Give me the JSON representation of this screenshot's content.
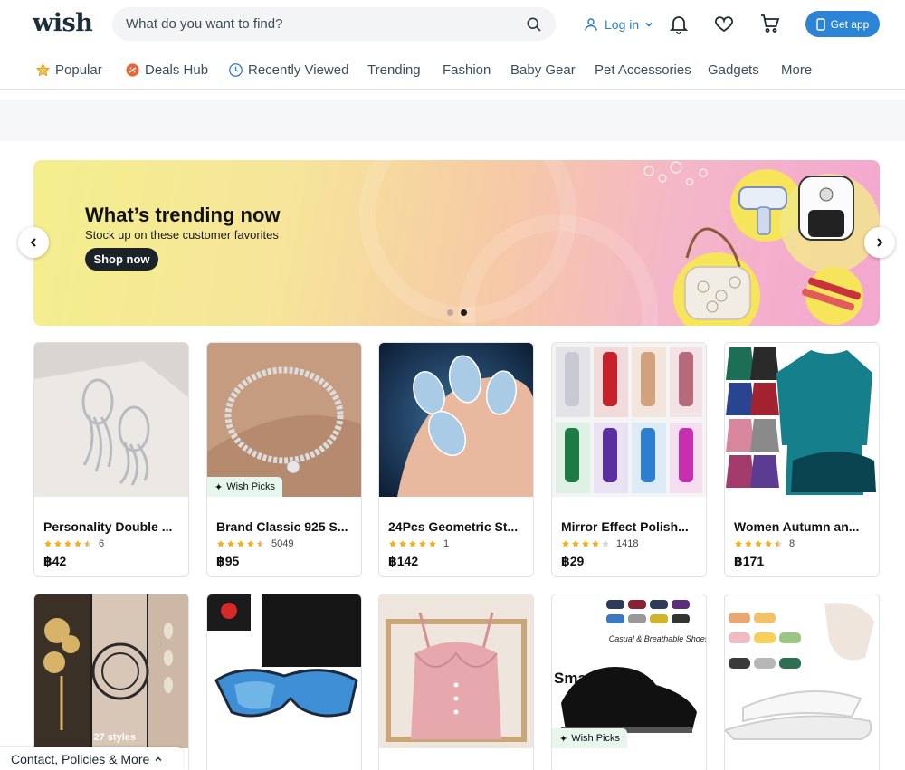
{
  "header": {
    "logo": "wish",
    "search_placeholder": "What do you want to find?",
    "login_label": "Log in",
    "get_app_label": "Get app",
    "icons": [
      "search-icon",
      "user-icon",
      "bell-icon",
      "heart-icon",
      "cart-icon",
      "phone-icon"
    ]
  },
  "nav": {
    "items": [
      {
        "label": "Popular",
        "icon": "star-icon"
      },
      {
        "label": "Deals Hub",
        "icon": "deals-icon"
      },
      {
        "label": "Recently Viewed",
        "icon": "clock-icon"
      },
      {
        "label": "Trending"
      },
      {
        "label": "Fashion"
      },
      {
        "label": "Baby Gear"
      },
      {
        "label": "Pet Accessories"
      },
      {
        "label": "Gadgets"
      },
      {
        "label": "More"
      }
    ]
  },
  "banner": {
    "title": "What’s trending now",
    "subtitle": "Stock up on these customer favorites",
    "cta": "Shop now",
    "slides": 2,
    "active_slide": 2
  },
  "products": [
    {
      "title": "Personality Double ...",
      "rating": 4.5,
      "count": "6",
      "price": "฿42"
    },
    {
      "title": "Brand Classic 925 S...",
      "rating": 4.5,
      "count": "5049",
      "price": "฿95",
      "badge": "Wish Picks"
    },
    {
      "title": "24Pcs Geometric St...",
      "rating": 5,
      "count": "1",
      "price": "฿142"
    },
    {
      "title": "Mirror Effect Polish...",
      "rating": 4,
      "count": "1418",
      "price": "฿29"
    },
    {
      "title": "Women Autumn an...",
      "rating": 4.5,
      "count": "8",
      "price": "฿171"
    }
  ],
  "products_row2": [
    {
      "image": "flower-earrings",
      "styles_label": "27 styles"
    },
    {
      "image": "dubery-sunglasses"
    },
    {
      "image": "pink-camisole"
    },
    {
      "image": "black-shoes",
      "badge": "Wish Picks"
    },
    {
      "image": "slide-sandals"
    }
  ],
  "footer": {
    "label": "Contact, Policies & More"
  },
  "colors": {
    "accent": "#2b84d6",
    "text": "#192a32",
    "star": "#f2b01e",
    "badge_bg": "#e7f7ee"
  }
}
